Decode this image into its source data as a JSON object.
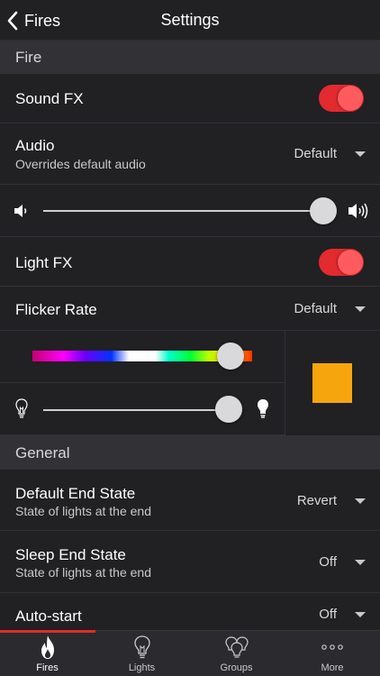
{
  "nav": {
    "back_label": "Fires",
    "title": "Settings"
  },
  "sections": {
    "fire": "Fire",
    "general": "General"
  },
  "sound_fx": {
    "label": "Sound FX",
    "enabled": true
  },
  "audio": {
    "label": "Audio",
    "subtitle": "Overrides default audio",
    "value": "Default"
  },
  "volume": {
    "level": 0.94
  },
  "light_fx": {
    "label": "Light FX",
    "enabled": true
  },
  "flicker_rate": {
    "label": "Flicker Rate",
    "value": "Default"
  },
  "color": {
    "hue_position": 0.9,
    "brightness": 0.94,
    "swatch": "#f6a60c"
  },
  "default_end_state": {
    "label": "Default End State",
    "subtitle": "State of lights at the end",
    "value": "Revert"
  },
  "sleep_end_state": {
    "label": "Sleep End State",
    "subtitle": "State of lights at the end",
    "value": "Off"
  },
  "auto_start": {
    "label": "Auto-start",
    "value": "Off"
  },
  "tabs": [
    {
      "label": "Fires",
      "icon": "flame-icon",
      "active": true
    },
    {
      "label": "Lights",
      "icon": "bulb-icon",
      "active": false
    },
    {
      "label": "Groups",
      "icon": "bulbs-group-icon",
      "active": false
    },
    {
      "label": "More",
      "icon": "more-icon",
      "active": false
    }
  ],
  "colors": {
    "accent": "#e22a2f",
    "background": "#212023",
    "section": "#323136",
    "tabbar": "#2b2a2e"
  }
}
